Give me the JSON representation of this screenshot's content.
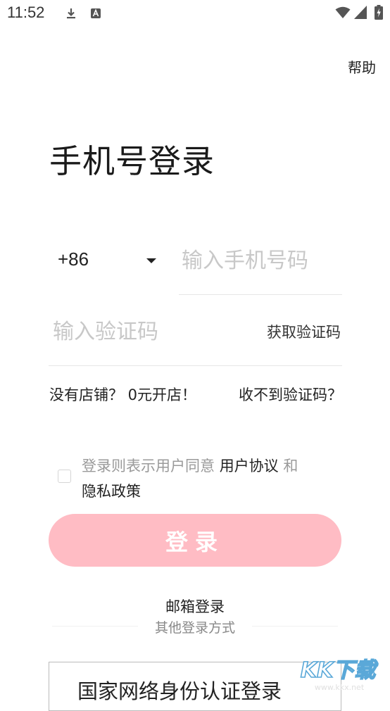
{
  "status_bar": {
    "time": "11:52"
  },
  "header": {
    "help": "帮助"
  },
  "page": {
    "title": "手机号登录"
  },
  "phone": {
    "country_code": "+86",
    "placeholder": "输入手机号码"
  },
  "code": {
    "placeholder": "输入验证码",
    "get_code": "获取验证码"
  },
  "links": {
    "no_shop": "没有店铺？ 0元开店！",
    "no_code": "收不到验证码？"
  },
  "agreement": {
    "prefix": "登录则表示用户同意 ",
    "user_agreement": "用户协议",
    "and": " 和 ",
    "privacy": "隐私政策"
  },
  "login": {
    "label": "登录"
  },
  "alt": {
    "email_login": "邮箱登录",
    "other_methods": "其他登录方式",
    "national_id": "国家网络身份认证登录"
  },
  "watermark": {
    "brand": "KK下载",
    "domain": "www.kkx.net"
  },
  "colors": {
    "primary_light": "#ffbcc4",
    "placeholder": "#c8c8c8"
  }
}
